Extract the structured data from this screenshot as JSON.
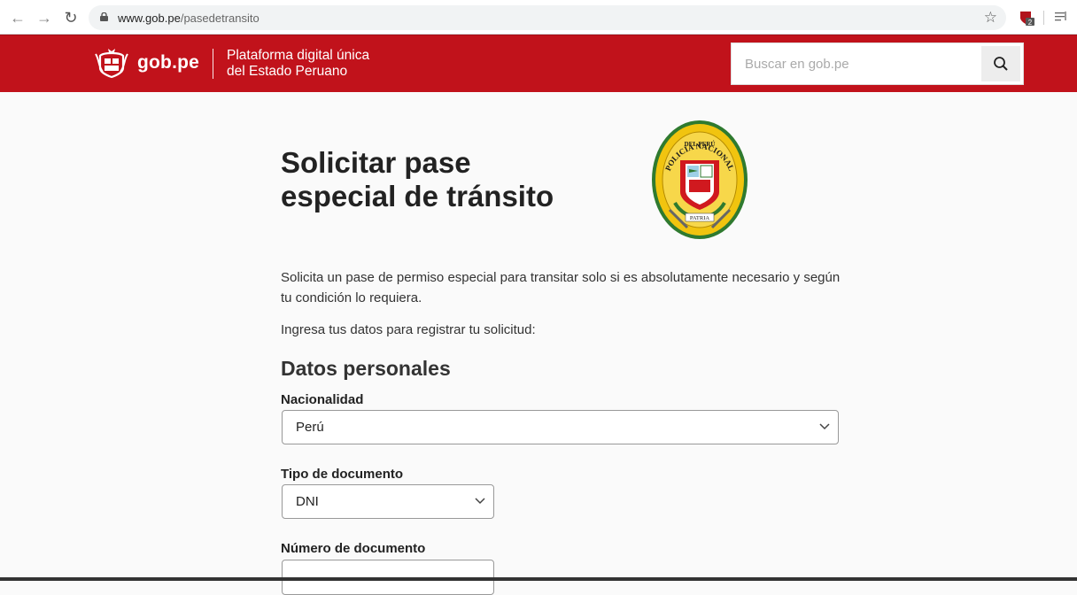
{
  "browser": {
    "url_host": "www.gob.pe",
    "url_path": "/pasedetransito"
  },
  "header": {
    "logo_text": "gob.pe",
    "platform_line1": "Plataforma digital única",
    "platform_line2": "del Estado Peruano",
    "search_placeholder": "Buscar en gob.pe",
    "brand_color": "#c1121b"
  },
  "main": {
    "title_line1": "Solicitar pase",
    "title_line2": "especial de tránsito",
    "badge_text_top": "POLICÍA NACIONAL",
    "badge_text_mid": "DEL PERÚ",
    "badge_text_bottom": "PATRIA",
    "intro": "Solicita un pase de permiso especial para transitar solo si es absolutamente necesario y según tu condición lo requiera.",
    "intro2": "Ingresa tus datos para registrar tu solicitud:",
    "section_title": "Datos personales"
  },
  "form": {
    "nacionalidad_label": "Nacionalidad",
    "nacionalidad_value": "Perú",
    "tipo_label": "Tipo de documento",
    "tipo_value": "DNI",
    "numero_label": "Número de documento",
    "numero_value": ""
  }
}
